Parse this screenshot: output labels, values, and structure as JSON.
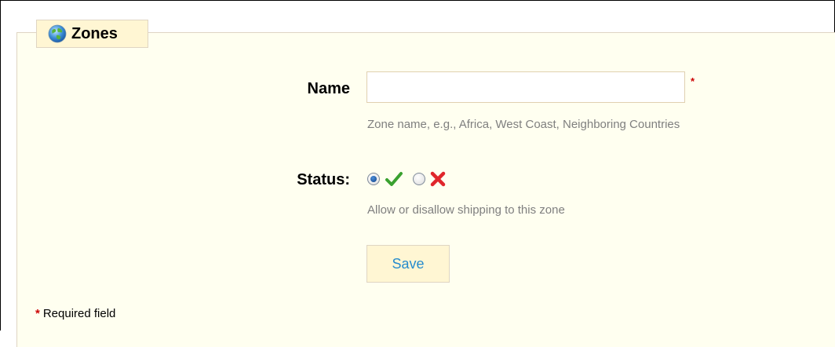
{
  "section": {
    "title": "Zones",
    "icon": "globe-icon"
  },
  "form": {
    "name": {
      "label": "Name",
      "value": "",
      "placeholder": "",
      "required_marker": "*",
      "hint": "Zone name, e.g., Africa, West Coast, Neighboring Countries"
    },
    "status": {
      "label": "Status:",
      "options": [
        {
          "icon": "check-icon",
          "selected": true
        },
        {
          "icon": "cross-icon",
          "selected": false
        }
      ],
      "hint": "Allow or disallow shipping to this zone"
    },
    "save_label": "Save"
  },
  "footer": {
    "required_marker": "*",
    "required_text": "Required field"
  },
  "colors": {
    "panel_bg": "#fffff0",
    "legend_bg": "#fff6d3",
    "border": "#dfd5c3",
    "hint": "#7f7f7f",
    "button_text": "#268ccd",
    "required": "#cc0000",
    "check": "#3aa12f",
    "cross": "#e0262b"
  }
}
